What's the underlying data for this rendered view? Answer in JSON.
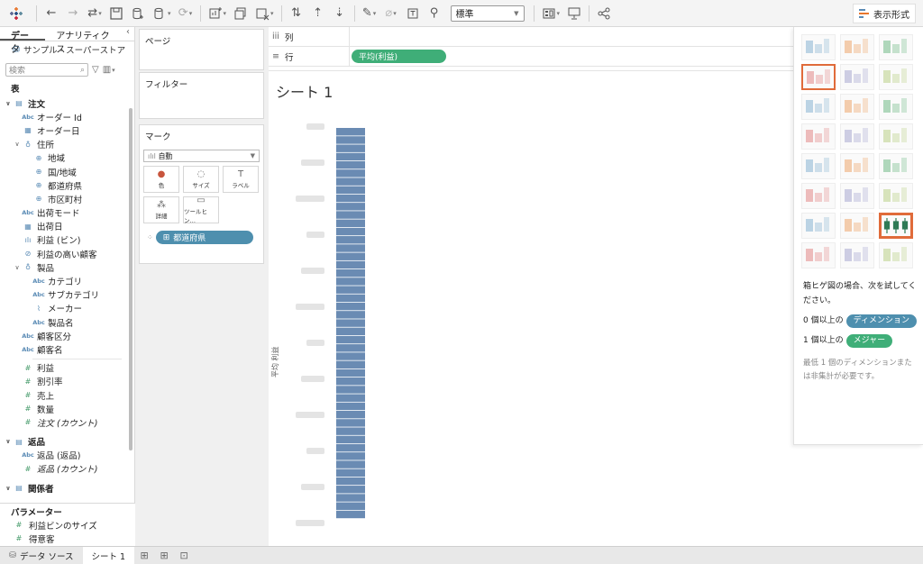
{
  "toolbar": {
    "format_select": "標準",
    "show_me_label": "表示形式"
  },
  "data_pane": {
    "tab_data": "データ",
    "tab_analytics": "アナリティクス",
    "datasource": "サンプル - スーパーストア",
    "search_placeholder": "検索",
    "tables_label": "表",
    "fields": [
      {
        "label": "注文",
        "icon": "table",
        "level": 0,
        "bold": true,
        "chev": "∨"
      },
      {
        "label": "オーダー Id",
        "icon": "abc",
        "level": 1
      },
      {
        "label": "オーダー日",
        "icon": "date",
        "level": 1
      },
      {
        "label": "住所",
        "icon": "hierarchy",
        "level": 1,
        "chev": "∨"
      },
      {
        "label": "地域",
        "icon": "globe",
        "level": 2
      },
      {
        "label": "国/地域",
        "icon": "globe",
        "level": 2
      },
      {
        "label": "都道府県",
        "icon": "globe",
        "level": 2
      },
      {
        "label": "市区町村",
        "icon": "globe",
        "level": 2
      },
      {
        "label": "出荷モード",
        "icon": "abc",
        "level": 1
      },
      {
        "label": "出荷日",
        "icon": "date",
        "level": 1
      },
      {
        "label": "利益 (ビン)",
        "icon": "bin",
        "level": 1
      },
      {
        "label": "利益の高い顧客",
        "icon": "set",
        "level": 1
      },
      {
        "label": "製品",
        "icon": "hierarchy",
        "level": 1,
        "chev": "∨"
      },
      {
        "label": "カテゴリ",
        "icon": "abc",
        "level": 2
      },
      {
        "label": "サブカテゴリ",
        "icon": "abc",
        "level": 2
      },
      {
        "label": "メーカー",
        "icon": "clip",
        "level": 2
      },
      {
        "label": "製品名",
        "icon": "abc",
        "level": 2
      },
      {
        "label": "顧客区分",
        "icon": "abc",
        "level": 1
      },
      {
        "label": "顧客名",
        "icon": "abc",
        "level": 1,
        "divider": true
      },
      {
        "label": "利益",
        "icon": "measure",
        "level": 1
      },
      {
        "label": "割引率",
        "icon": "measure",
        "level": 1
      },
      {
        "label": "売上",
        "icon": "measure",
        "level": 1
      },
      {
        "label": "数量",
        "icon": "measure",
        "level": 1
      },
      {
        "label": "注文 (カウント)",
        "icon": "measure",
        "level": 1,
        "italic": true,
        "gap": true
      },
      {
        "label": "返品",
        "icon": "table",
        "level": 0,
        "bold": true,
        "chev": "∨"
      },
      {
        "label": "返品 (返品)",
        "icon": "abc",
        "level": 1
      },
      {
        "label": "返品 (カウント)",
        "icon": "measure",
        "level": 1,
        "italic": true,
        "gap": true
      },
      {
        "label": "関係者",
        "icon": "table",
        "level": 0,
        "bold": true,
        "chev": "∨"
      }
    ],
    "parameters_label": "パラメーター",
    "parameters": [
      {
        "label": "利益ビンのサイズ"
      },
      {
        "label": "得意客"
      }
    ]
  },
  "shelves": {
    "pages_label": "ページ",
    "filters_label": "フィルター",
    "marks_label": "マーク",
    "marks_type": "自動",
    "mark_buttons": [
      {
        "label": "色",
        "icon": "●"
      },
      {
        "label": "サイズ",
        "icon": "◌"
      },
      {
        "label": "ラベル",
        "icon": "T"
      },
      {
        "label": "詳細",
        "icon": "⁂"
      },
      {
        "label": "ツールヒン…",
        "icon": "▭"
      }
    ],
    "marks_pill": "都道府県",
    "columns_label": "列",
    "rows_label": "行",
    "rows_pill": "平均(利益)"
  },
  "view": {
    "sheet_title": "シート 1",
    "axis_title": "平均 利益"
  },
  "show_me": {
    "hint_title": "箱ヒゲ図の場合、次を試してください。",
    "line1_prefix": "0 個以上の",
    "line1_pill": "ディメンション",
    "line2_prefix": "1 個以上の",
    "line2_pill": "メジャー",
    "note": "最低 1 個のディメンションまたは非集計が必要です。"
  },
  "tabs": {
    "datasource": "データ ソース",
    "sheet": "シート 1"
  },
  "colors": {
    "bar": "#6a8bb3",
    "pill_blue": "#4e8fae",
    "pill_green": "#3fae78",
    "highlight": "#e06b3a"
  }
}
